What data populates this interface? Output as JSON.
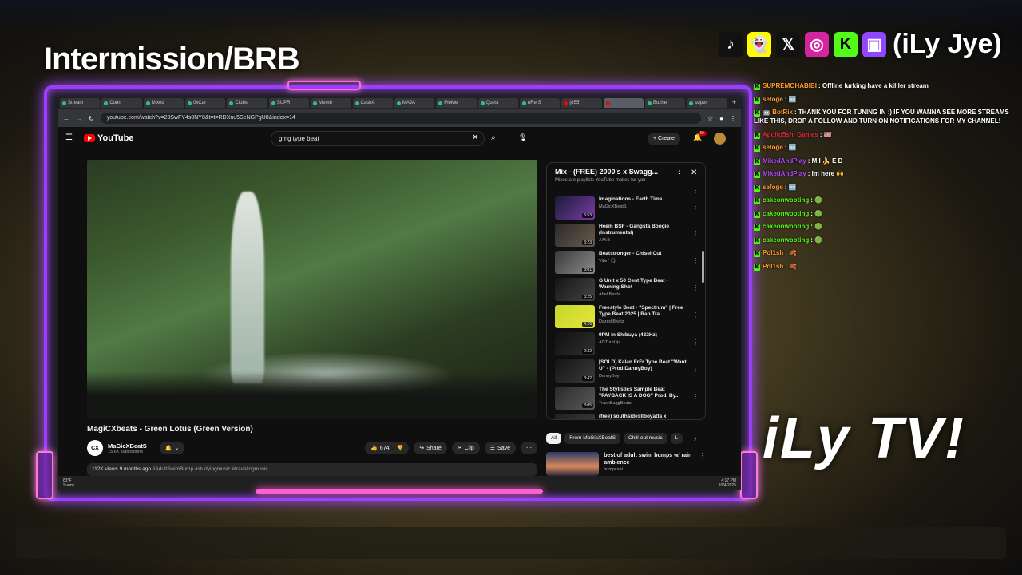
{
  "overlay": {
    "title": "Intermission/BRB",
    "handle": "(iLy Jye)",
    "brand": "iLy TV!",
    "socials": [
      {
        "icon": "tiktok-icon",
        "glyph": "♪",
        "color": "#111111"
      },
      {
        "icon": "snapchat-icon",
        "glyph": "👻",
        "color": "#fffc00"
      },
      {
        "icon": "x-icon",
        "glyph": "𝕏",
        "color": "#111111"
      },
      {
        "icon": "instagram-icon",
        "glyph": "◎",
        "color": "#d6249f"
      },
      {
        "icon": "kick-icon",
        "glyph": "K",
        "color": "#53fc18"
      },
      {
        "icon": "twitch-icon",
        "glyph": "▣",
        "color": "#9146ff"
      }
    ],
    "accent": "#9d3cff"
  },
  "browser": {
    "tabs": [
      "Stream",
      "Conn",
      "Mixed",
      "0xCar",
      "Clubs",
      "SUPR",
      "Memb",
      "CashA",
      "MAJA",
      "PieMe",
      "Quest",
      "nRe S",
      "(855)",
      "",
      "Bozhe",
      "super"
    ],
    "url": "youtube.com/watch?v=23SwFY4s0NY8&t=t=RDXnu5SeNGPgU8&index=14"
  },
  "youtube": {
    "logo": "YouTube",
    "search_value": "gmg type beat",
    "create_label": "Create",
    "notif_count": "9+",
    "video_title": "MagiCXbeats - Green Lotus (Green Version)",
    "channel_name": "MaGicXBeatS",
    "avatar_text": "CX",
    "subscribers": "15.6K subscribers",
    "likes": "674",
    "share_label": "Share",
    "clip_label": "Clip",
    "save_label": "Save",
    "views": "112K views  9 months ago",
    "tags": "#AdultSwimBump #studyingmusic #travelingmusic",
    "mix": {
      "title": "Mix - (FREE) 2000's x Swagg...",
      "subtitle": "Mixes are playlists YouTube makes for you",
      "items": [
        {
          "title": "Imaginations - Earth Time",
          "channel": "MaGicXBeatS",
          "duration": "5:53",
          "c1": "#1b1b3a",
          "c2": "#7a3ba3"
        },
        {
          "title": "Heem BSF - Gangsta Boogie (Instrumental)",
          "channel": "J.M.B",
          "duration": "3:23",
          "c1": "#2b2b2b",
          "c2": "#6a5a4a"
        },
        {
          "title": "Beatstronger - Chisel Cut",
          "channel": "Vibin' 🎧",
          "duration": "3:01",
          "c1": "#3a3a3a",
          "c2": "#8a8a8a"
        },
        {
          "title": "G Unit x 50 Cent Type Beat - Warning Shot",
          "channel": "Abel Beats",
          "duration": "3:25",
          "c1": "#151515",
          "c2": "#444444"
        },
        {
          "title": "Freestyle Beat - \"Spectrum\" | Free Type Beat 2025 | Rap Tra...",
          "channel": "Dazed Beatz",
          "duration": "4:26",
          "c1": "#c6d62a",
          "c2": "#e6e63a"
        },
        {
          "title": "9PM in Shibuya (432Hz)",
          "channel": "ADTurnUp",
          "duration": "2:32",
          "c1": "#101010",
          "c2": "#303030"
        },
        {
          "title": "[SOLD] Kalan.FrFr Type Beat \"Want U\" - (Prod.DannyBoy)",
          "channel": "DannyBoy",
          "duration": "3:42",
          "c1": "#151515",
          "c2": "#3a3a3a"
        },
        {
          "title": "The Stylistics Sample Beat \"PAYBACK IS A DOG\" Prod. By...",
          "channel": "TrashBaggBeatz",
          "duration": "3:05",
          "c1": "#2a2a2a",
          "c2": "#5a5a5a"
        },
        {
          "title": "(free) southsidesllboyatta x",
          "channel": "",
          "duration": "",
          "c1": "#202020",
          "c2": "#404040"
        }
      ]
    },
    "chips": [
      "All",
      "From MaGicXBeatS",
      "Chill-out music",
      "L"
    ],
    "rec": {
      "title": "best of adult swim bumps w/ rain ambience",
      "channel": "bumpcast"
    }
  },
  "taskbar": {
    "temp": "83°F",
    "weather": "Sunny",
    "time": "4:17 PM",
    "date": "10/4/2025"
  },
  "chat": [
    {
      "user": "SUPREMOHABIBI",
      "color": "#ff9a2e",
      "badge": "",
      "text": "Offline lurking have a killler stream"
    },
    {
      "user": "sefoge",
      "color": "#ff9a2e",
      "badge": "",
      "text": "🆕"
    },
    {
      "user": "BotRix",
      "color": "#ff9a2e",
      "badge": "🤖",
      "text": "THANK YOU FOR TUNING IN :) IF YOU WANNA SEE MORE STREAMS LIKE THIS, DROP A FOLLOW AND TURN ON NOTIFICATIONS FOR MY CHANNEL!"
    },
    {
      "user": "Apollo5sh_Games",
      "color": "#e0283a",
      "badge": "",
      "text": "🇺🇸"
    },
    {
      "user": "sefoge",
      "color": "#ff9a2e",
      "badge": "",
      "text": "🆕"
    },
    {
      "user": "MikedAndPlay",
      "color": "#b04bff",
      "badge": "",
      "text": "M I 🍌 E D"
    },
    {
      "user": "MikedAndPlay",
      "color": "#b04bff",
      "badge": "",
      "text": "Im here 🙌"
    },
    {
      "user": "sefoge",
      "color": "#ff9a2e",
      "badge": "",
      "text": "🆕"
    },
    {
      "user": "cakeonwooting",
      "color": "#53fc18",
      "badge": "",
      "text": "🟢"
    },
    {
      "user": "cakeonwooting",
      "color": "#53fc18",
      "badge": "",
      "text": "🟢"
    },
    {
      "user": "cakeonwooting",
      "color": "#53fc18",
      "badge": "",
      "text": "🟢"
    },
    {
      "user": "cakeonwooting",
      "color": "#53fc18",
      "badge": "",
      "text": "🟢"
    },
    {
      "user": "Pol1sh",
      "color": "#ff9a2e",
      "badge": "",
      "text": "🍂"
    },
    {
      "user": "Pol1sh",
      "color": "#ff9a2e",
      "badge": "",
      "text": "🍂"
    }
  ]
}
